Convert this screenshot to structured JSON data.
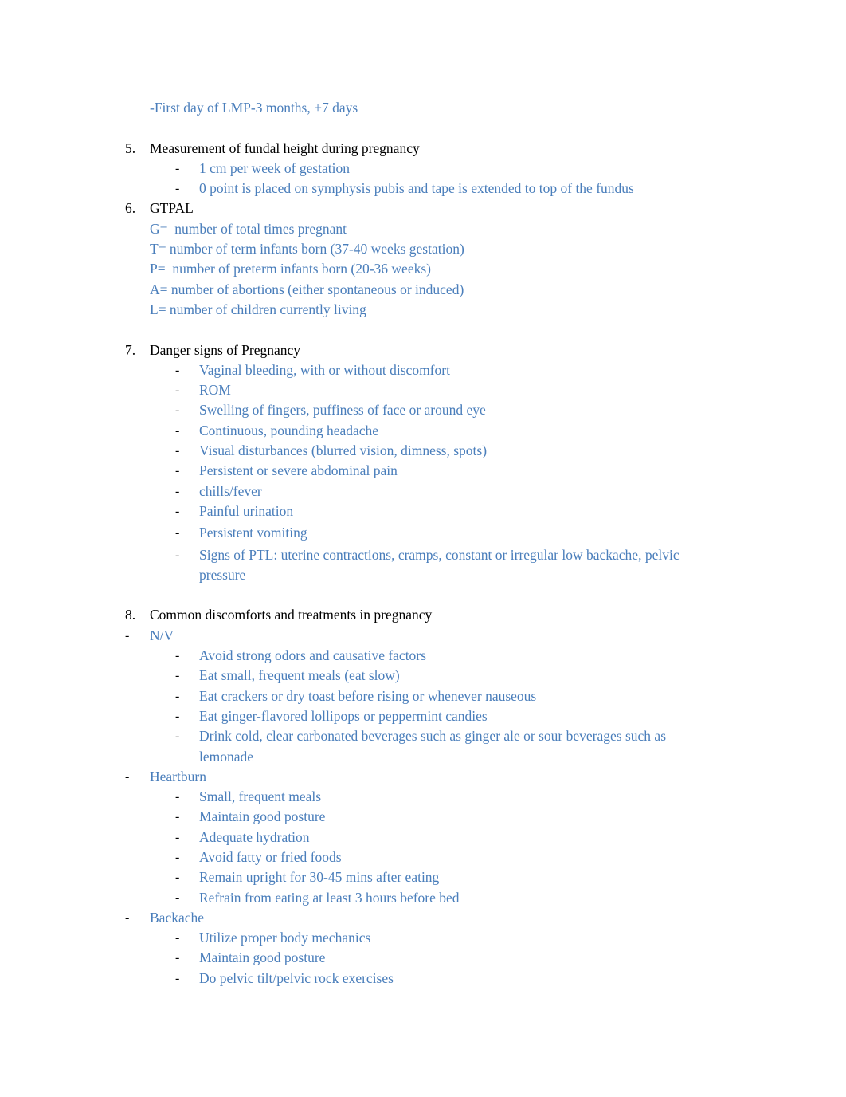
{
  "document": {
    "page_background": "#ffffff",
    "accent_color": "#4a7ebb",
    "text_color": "#000000"
  },
  "intro": {
    "line": "-First day of LMP-3 months, +7 days"
  },
  "markers": {
    "dash": "-",
    "num5": "5.",
    "num6": "6.",
    "num7": "7.",
    "num8": "8."
  },
  "sections": [
    {
      "number": "5.",
      "heading": "Measurement of fundal height during pregnancy",
      "bullets": [
        "1 cm per week of gestation",
        "0 point is placed on symphysis pubis and tape is extended to top of the fundus"
      ]
    },
    {
      "number": "6.",
      "heading": "GTPAL",
      "lines": [
        "G=  number of total times pregnant",
        "T= number of term infants born (37-40 weeks gestation)",
        "P=  number of preterm infants born (20-36 weeks)",
        "A= number of abortions (either spontaneous or induced)",
        "L= number of children currently living"
      ]
    },
    {
      "number": "7.",
      "heading": "Danger signs of Pregnancy",
      "bullets": [
        "Vaginal bleeding, with or without discomfort",
        "ROM",
        "Swelling of fingers, puffiness of face or around eye",
        "Continuous, pounding headache",
        "Visual disturbances (blurred vision, dimness, spots)",
        "Persistent or severe abdominal pain",
        "chills/fever",
        "Painful urination",
        "Persistent vomiting",
        "Signs of PTL: uterine contractions, cramps, constant or irregular low backache, pelvic pressure"
      ]
    },
    {
      "number": "8.",
      "heading": "Common discomforts and treatments in pregnancy",
      "groups": [
        {
          "label": "N/V",
          "items": [
            "Avoid strong odors and causative factors",
            "Eat small, frequent meals (eat slow)",
            "Eat crackers or dry toast before rising or whenever nauseous",
            "Eat ginger-flavored lollipops or peppermint candies",
            "Drink cold, clear carbonated beverages such as ginger ale or sour beverages such as lemonade"
          ]
        },
        {
          "label": "Heartburn",
          "items": [
            "Small, frequent meals",
            "Maintain good posture",
            "Adequate hydration",
            "Avoid fatty or fried foods",
            "Remain upright for 30-45 mins after eating",
            "Refrain from eating at least 3 hours before bed"
          ]
        },
        {
          "label": "Backache",
          "items": [
            "Utilize proper body mechanics",
            "Maintain good posture",
            "Do pelvic tilt/pelvic rock exercises"
          ]
        }
      ]
    }
  ]
}
